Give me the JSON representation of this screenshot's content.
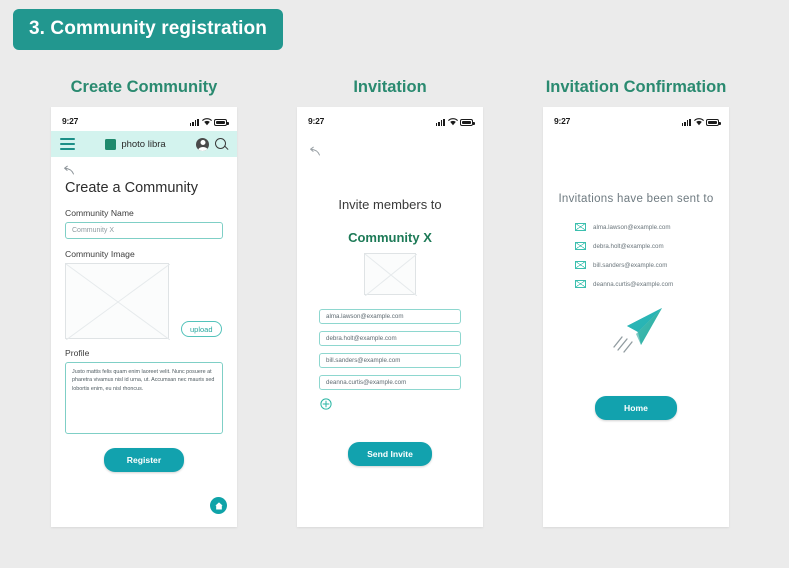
{
  "section": {
    "badge": "3. Community registration"
  },
  "theme": {
    "background": "#ebebeb",
    "badge_bg": "#22978f",
    "title_color": "#2a8a70",
    "accent": "#12a2ae",
    "appbar_bg": "#d3f3ee",
    "input_border": "#7fcfc6"
  },
  "status_bar": {
    "time": "9:27",
    "icons": [
      "signal-icon",
      "wifi-icon",
      "battery-icon"
    ]
  },
  "screens": [
    {
      "title": "Create Community",
      "appbar": {
        "menu_icon": "hamburger-icon",
        "brand": "photo libra",
        "avatar_icon": "avatar-icon",
        "search_icon": "search-icon"
      },
      "back_icon": "back-arrow-icon",
      "heading": "Create a Community",
      "fields": {
        "name_label": "Community Name",
        "name_value": "Community X",
        "image_label": "Community Image",
        "upload_label": "upload",
        "profile_label": "Profile",
        "profile_value": "Justo mattis felis quam enim laoreet velit. Nunc posuere at pharetra vivamus nisl id urna, ut. Accumsan nec mauris sed lobortis enim, eu nisl rhoncus."
      },
      "cta": "Register",
      "home_icon": "home-icon"
    },
    {
      "title": "Invitation",
      "back_icon": "back-arrow-icon",
      "heading": "Invite members to",
      "community": "Community X",
      "emails": [
        "alma.lawson@example.com",
        "debra.holt@example.com",
        "bill.sanders@example.com",
        "deanna.curtis@example.com"
      ],
      "add_icon": "plus-circle-icon",
      "cta": "Send Invite"
    },
    {
      "title": "Invitation Confirmation",
      "heading": "Invitations  have been sent  to",
      "emails": [
        "alma.lawson@example.com",
        "debra.holt@example.com",
        "bill.sanders@example.com",
        "deanna.curtis@example.com"
      ],
      "illustration": "paper-plane-icon",
      "cta": "Home"
    }
  ]
}
